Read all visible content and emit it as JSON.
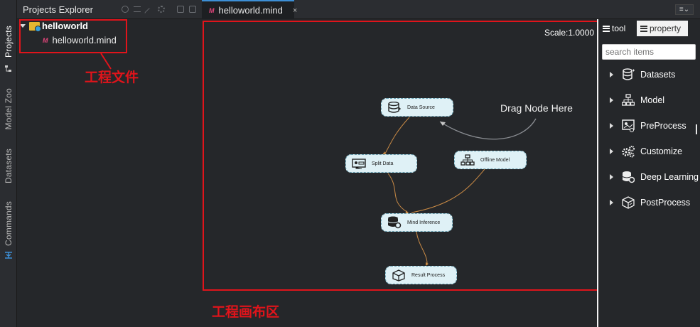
{
  "sidebar_tabs": [
    {
      "label": "Projects"
    },
    {
      "label": "Model Zoo"
    },
    {
      "label": "Datasets"
    },
    {
      "label": "Commands"
    }
  ],
  "explorer": {
    "title": "Projects Explorer",
    "root": {
      "label": "helloworld",
      "icon": "folder-icon"
    },
    "file": {
      "label": "helloworld.mind",
      "icon": "mind-file-icon"
    }
  },
  "annotations": {
    "project_file": "工程文件",
    "canvas_area": "工程画布区"
  },
  "editor": {
    "tab_label": "helloworld.mind",
    "close_glyph": "×",
    "menu_glyph": "≡⌄",
    "scale_label": "Scale:1.0000",
    "drag_hint": "Drag Node Here"
  },
  "nodes": [
    {
      "id": "data-source",
      "label": "Data Source",
      "icon": "database-icon"
    },
    {
      "id": "split-data",
      "label": "Split Data",
      "icon": "split-icon"
    },
    {
      "id": "offline-model",
      "label": "Offline Model",
      "icon": "hierarchy-icon"
    },
    {
      "id": "mind-inference",
      "label": "Mind Inference",
      "icon": "database-gear-icon"
    },
    {
      "id": "result-process",
      "label": "Result Process",
      "icon": "box-icon"
    }
  ],
  "right_panel": {
    "tabs": [
      {
        "label": "tool",
        "active": true
      },
      {
        "label": "property",
        "active": false
      }
    ],
    "search_placeholder": "search items",
    "categories": [
      {
        "label": "Datasets",
        "icon": "database-add-icon"
      },
      {
        "label": "Model",
        "icon": "hierarchy-icon"
      },
      {
        "label": "PreProcess",
        "icon": "image-settings-icon"
      },
      {
        "label": "Customize",
        "icon": "gears-icon"
      },
      {
        "label": "Deep Learning",
        "icon": "database-gear-icon"
      },
      {
        "label": "PostProcess",
        "icon": "box-icon"
      }
    ]
  },
  "colors": {
    "accent": "#3d8fd6",
    "annotation_red": "#e0141b",
    "node_fill": "#dff1f6",
    "edge": "#c98a45"
  }
}
